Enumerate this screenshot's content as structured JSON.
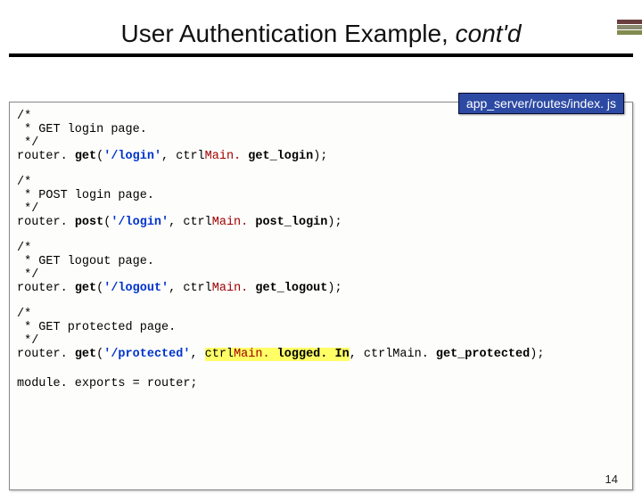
{
  "title": {
    "main": "User Authentication Example, ",
    "tail": "cont'd"
  },
  "file_label": "app_server/routes/index. js",
  "page_number": "14",
  "blocks": [
    {
      "comment_open": "/*",
      "comment_body": " * GET login page.",
      "comment_close": " */",
      "call_prefix": "router. ",
      "method": "get",
      "paren_open": "(",
      "path": "'/login'",
      "after_path": ", ctrl",
      "main_dot": "Main. ",
      "handler": "get_login",
      "tail": ");"
    },
    {
      "comment_open": "/*",
      "comment_body": " * POST login page.",
      "comment_close": " */",
      "call_prefix": "router. ",
      "method": "post",
      "paren_open": "(",
      "path": "'/login'",
      "after_path": ", ctrl",
      "main_dot": "Main. ",
      "handler": "post_login",
      "tail": ");"
    },
    {
      "comment_open": "/*",
      "comment_body": " * GET logout page.",
      "comment_close": " */",
      "call_prefix": "router. ",
      "method": "get",
      "paren_open": "(",
      "path": "'/logout'",
      "after_path": ", ctrl",
      "main_dot": "Main. ",
      "handler": "get_logout",
      "tail": ");"
    },
    {
      "comment_open": "/*",
      "comment_body": " * GET protected page.",
      "comment_close": " */",
      "call_prefix": "router. ",
      "method": "get",
      "paren_open": "(",
      "path": "'/protected'",
      "after_path": ", ",
      "mid_hl_pre": "ctrl",
      "mid_main_dot": "Main. ",
      "mid_handler": "logged. In",
      "mid_hl_post": ", ",
      "main_dot": "ctrlMain. ",
      "handler": "get_protected",
      "tail": ");",
      "has_middleware": true
    }
  ],
  "export_line": "module. exports = router;"
}
